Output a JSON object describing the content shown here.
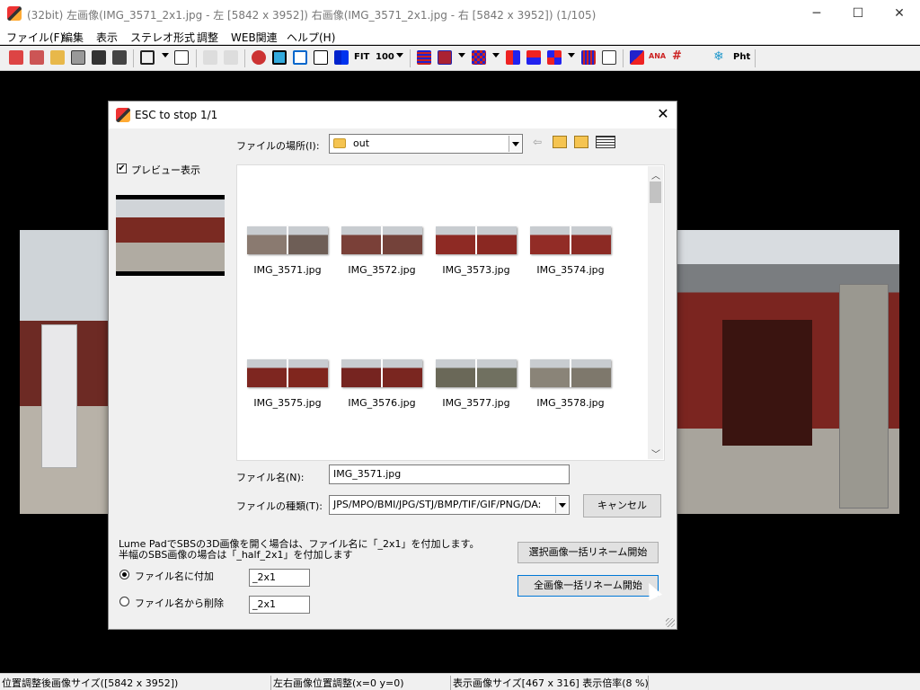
{
  "window": {
    "title": "(32bit) 左画像(IMG_3571_2x1.jpg - 左 [5842 x 3952]) 右画像(IMG_3571_2x1.jpg - 右 [5842 x 3952])  (1/105)",
    "minimize": "─",
    "maximize": "☐",
    "close": "✕"
  },
  "menu": [
    "ファイル(F)",
    "編集",
    "表示",
    "ステレオ形式",
    "調整",
    "WEB関連",
    "ヘルプ(H)"
  ],
  "toolbar": {
    "fit_label": "FIT",
    "zoom_label": "100",
    "pht_label": "Pht",
    "anaglyph_label": "ANA"
  },
  "status": {
    "cell1": "位置調整後画像サイズ([5842 x 3952])",
    "cell2": "左右画像位置調整(x=0 y=0)",
    "cell3": "表示画像サイズ[467 x 316]  表示倍率(8 %)"
  },
  "dialog": {
    "title": "ESC to stop  1/1",
    "close": "✕",
    "location_label": "ファイルの場所(I):",
    "location_value": "out",
    "preview_check": "✔",
    "preview_label": "プレビュー表示",
    "files": [
      {
        "name": "IMG_3571.jpg",
        "c1": "#8a7a70",
        "c2": "#6e5e56"
      },
      {
        "name": "IMG_3572.jpg",
        "c1": "#7a4038",
        "c2": "#74423a"
      },
      {
        "name": "IMG_3573.jpg",
        "c1": "#8e2a24",
        "c2": "#8a2822"
      },
      {
        "name": "IMG_3574.jpg",
        "c1": "#922c26",
        "c2": "#8c2a24"
      },
      {
        "name": "IMG_3575.jpg",
        "c1": "#7e2620",
        "c2": "#80261e"
      },
      {
        "name": "IMG_3576.jpg",
        "c1": "#762420",
        "c2": "#7a2620"
      },
      {
        "name": "IMG_3577.jpg",
        "c1": "#6a6858",
        "c2": "#707060"
      },
      {
        "name": "IMG_3578.jpg",
        "c1": "#8a8478",
        "c2": "#7e786c"
      }
    ],
    "filename_label": "ファイル名(N):",
    "filename_value": "IMG_3571.jpg",
    "filetype_label": "ファイルの種類(T):",
    "filetype_value": "JPS/MPO/BMI/JPG/STJ/BMP/TIF/GIF/PNG/DA:",
    "cancel": "キャンセル",
    "note1": "Lume PadでSBSの3D画像を開く場合は、ファイル名に「_2x1」を付加します。",
    "note2": "半幅のSBS画像の場合は「_half_2x1」を付加します",
    "radio_add": "ファイル名に付加",
    "radio_add_value": "_2x1",
    "radio_remove": "ファイル名から削除",
    "radio_remove_value": "_2x1",
    "btn_rename_selected": "選択画像一括リネーム開始",
    "btn_rename_all": "全画像一括リネーム開始"
  }
}
